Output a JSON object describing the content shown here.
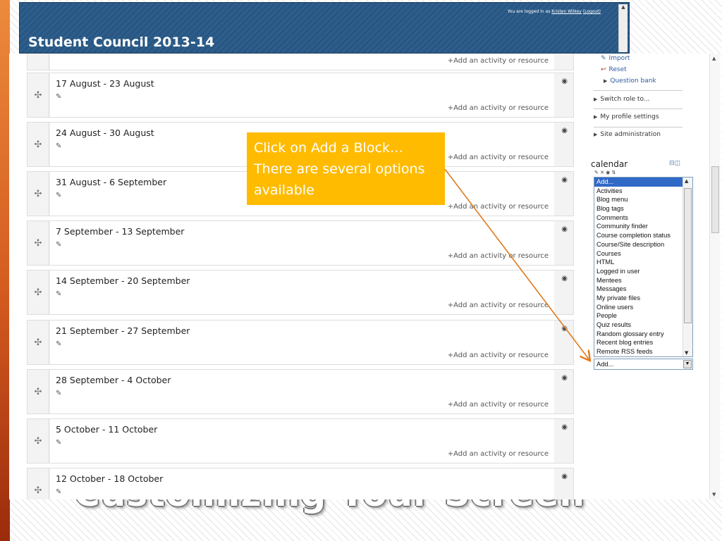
{
  "slide": {
    "title": "Customizing Your Screen"
  },
  "header": {
    "site_title": "Student Council 2013-14",
    "login_prefix": "You are logged in as",
    "user_name": "Kristen Wilkey",
    "logout_label": "(Logout)"
  },
  "weeks": {
    "add_label": "+Add an activity or resource",
    "items": [
      {
        "title": ""
      },
      {
        "title": "17 August - 23 August"
      },
      {
        "title": "24 August - 30 August"
      },
      {
        "title": "31 August - 6 September"
      },
      {
        "title": "7 September - 13 September"
      },
      {
        "title": "14 September - 20 September"
      },
      {
        "title": "21 September - 27 September"
      },
      {
        "title": "28 September - 4 October"
      },
      {
        "title": "5 October - 11 October"
      },
      {
        "title": "12 October - 18 October"
      }
    ]
  },
  "admin": {
    "import_label": "Import",
    "reset_label": "Reset",
    "question_bank_label": "Question bank",
    "switch_role_label": "Switch role to...",
    "profile_settings_label": "My profile settings",
    "site_admin_label": "Site administration"
  },
  "calendar": {
    "title": "calendar"
  },
  "add_block": {
    "options": [
      "Add...",
      "Activities",
      "Blog menu",
      "Blog tags",
      "Comments",
      "Community finder",
      "Course completion status",
      "Course/Site description",
      "Courses",
      "HTML",
      "Logged in user",
      "Mentees",
      "Messages",
      "My private files",
      "Online users",
      "People",
      "Quiz results",
      "Random glossary entry",
      "Recent blog entries",
      "Remote RSS feeds"
    ],
    "selected_value": "Add..."
  },
  "callout": {
    "text": "Click on Add a Block… There are several options available"
  },
  "colors": {
    "header_blue": "#2e5f8c",
    "callout_orange": "#ffbb00",
    "arrow_orange": "#e07a1e",
    "selection_blue": "#3169c6"
  }
}
